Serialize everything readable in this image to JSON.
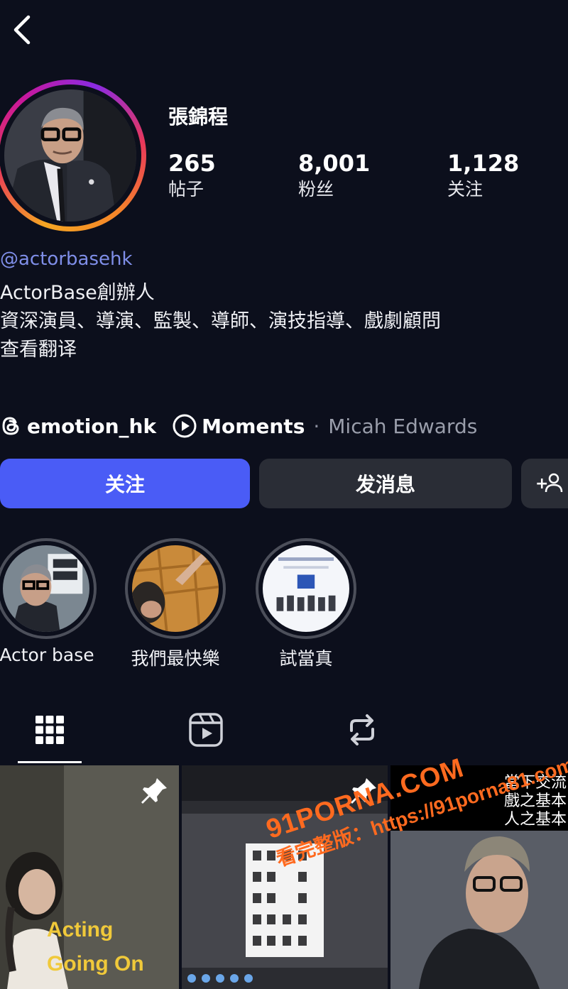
{
  "profile": {
    "name": "張錦程",
    "handle": "@actorbasehk",
    "stats": [
      {
        "value": "265",
        "label": "帖子"
      },
      {
        "value": "8,001",
        "label": "粉丝"
      },
      {
        "value": "1,128",
        "label": "关注"
      }
    ],
    "bio": [
      "ActorBase創辦人",
      "資深演員、導演、監製、導師、演技指導、戲劇顧問"
    ],
    "translate": "查看翻译",
    "threads_handle": "emotion_hk",
    "moments_label": "Moments",
    "moments_separator": "·",
    "moments_author": "Micah Edwards"
  },
  "actions": {
    "follow": "关注",
    "message": "发消息",
    "suggest": "+"
  },
  "highlights": [
    {
      "label": "Actor base"
    },
    {
      "label": "我們最快樂"
    },
    {
      "label": "試當真"
    }
  ],
  "tabs": [
    {
      "icon": "grid-icon",
      "active": true
    },
    {
      "icon": "reels-icon",
      "active": false
    },
    {
      "icon": "reposts-icon",
      "active": false
    }
  ],
  "posts": [
    {
      "caption": [
        "Acting",
        "Going On"
      ],
      "pinned": true
    },
    {
      "pinned": true
    },
    {
      "title": [
        "當下交流",
        "戲之基本",
        "人之基本"
      ]
    }
  ],
  "watermark": {
    "brand": "91PORNA.COM",
    "url": "看完整版：https://91porna81.com"
  },
  "colors": {
    "background": "#0c0f1c",
    "accent": "#4a5cf6",
    "handle": "#7f8ee8",
    "secondary_button": "#2a2d36"
  }
}
